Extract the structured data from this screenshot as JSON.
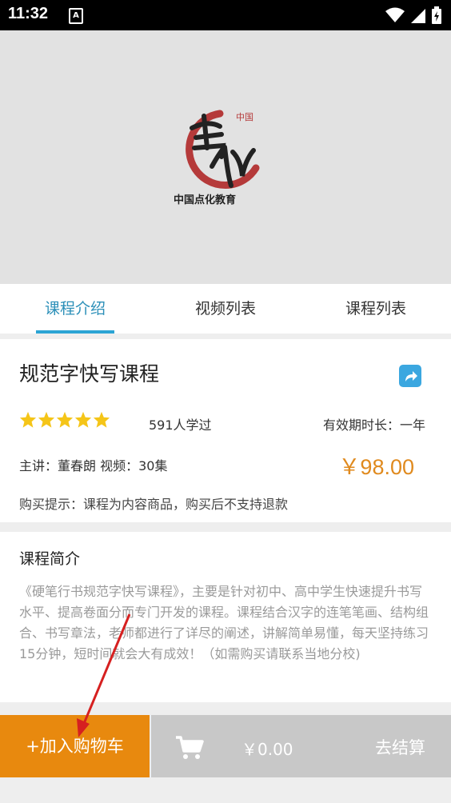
{
  "status_bar": {
    "time": "11:32",
    "notification_letter": "A"
  },
  "hero": {
    "logo_text_main": "点化",
    "logo_text_small": "中国",
    "logo_caption": "中国点化教育"
  },
  "tabs": [
    {
      "label": "课程介绍",
      "active": true
    },
    {
      "label": "视频列表",
      "active": false
    },
    {
      "label": "课程列表",
      "active": false
    }
  ],
  "course": {
    "title": "规范字快写课程",
    "rating_stars": 5,
    "learned": "591人学过",
    "validity": "有效期时长：一年",
    "teacher": "主讲：董春朗  视频：30集",
    "price": "￥98.00",
    "tip": "购买提示：课程为内容商品，购买后不支持退款"
  },
  "intro": {
    "heading": "课程简介",
    "body": "《硬笔行书规范字快写课程》，主要是针对初中、高中学生快速提升书写水平、提高卷面分而专门开发的课程。课程结合汉字的连笔笔画、结构组合、书写章法，老师都进行了详尽的阐述，讲解简单易懂，每天坚持练习15分钟，短时间就会大有成效！（如需购买请联系当地分校)"
  },
  "bottom_bar": {
    "add_to_cart": "+加入购物车",
    "total": "￥0.00",
    "checkout": "去结算"
  },
  "colors": {
    "accent": "#2ba4d4",
    "price": "#e08a1e",
    "cart_button": "#e8890e",
    "star": "#f5c518"
  }
}
